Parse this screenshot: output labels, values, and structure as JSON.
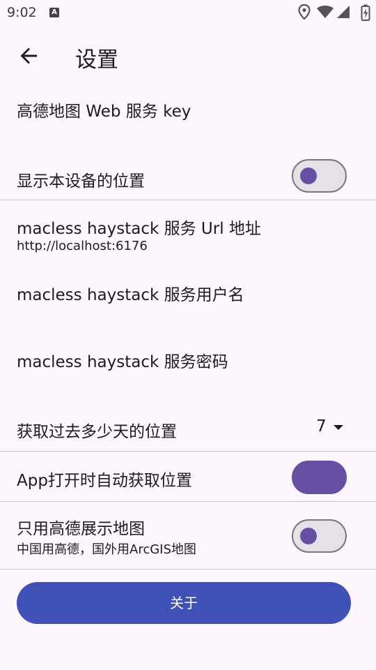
{
  "status_bar": {
    "time": "9:02",
    "notification_icon": "a-badge-icon",
    "icons": [
      "location-icon",
      "wifi-icon",
      "signal-icon",
      "battery-charging-icon"
    ]
  },
  "header": {
    "back_icon": "arrow-back-icon",
    "title": "设置"
  },
  "settings": {
    "amap_key": {
      "title": "高德地图 Web 服务 key"
    },
    "show_device_location": {
      "title": "显示本设备的位置",
      "enabled": false
    },
    "server_url": {
      "title": "macless haystack 服务 Url 地址",
      "value": "http://localhost:6176"
    },
    "server_username": {
      "title": "macless haystack 服务用户名"
    },
    "server_password": {
      "title": "macless haystack 服务密码"
    },
    "days_to_fetch": {
      "title": "获取过去多少天的位置",
      "value": "7"
    },
    "auto_fetch_on_open": {
      "title": "App打开时自动获取位置",
      "enabled": true
    },
    "amap_only": {
      "title": "只用高德展示地图",
      "subtitle": "中国用高德，国外用ArcGIS地图",
      "enabled": false
    }
  },
  "about_button": {
    "label": "关于"
  },
  "colors": {
    "background": "#fdf7fd",
    "accent": "#6750a4",
    "button": "#3f51b5",
    "divider": "#c9c5cc"
  }
}
